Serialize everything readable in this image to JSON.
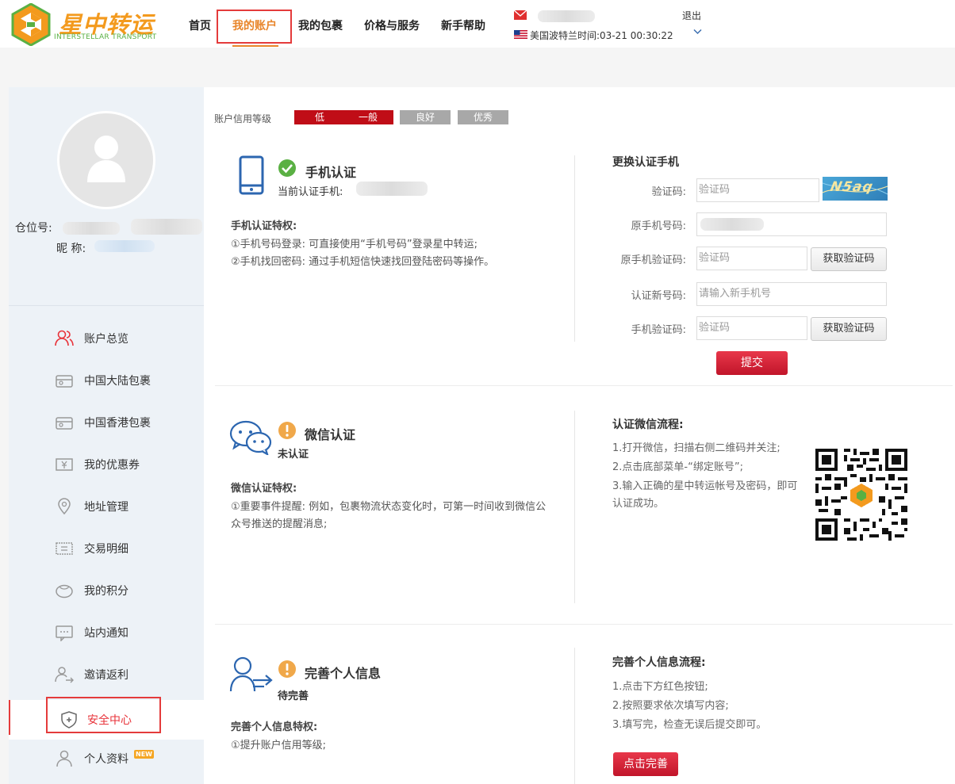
{
  "header": {
    "brand_cn": "星中转运",
    "brand_en": "INTERSTELLAR TRANSPORT",
    "nav": [
      {
        "label": "首页"
      },
      {
        "label": "我的账户"
      },
      {
        "label": "我的包裹"
      },
      {
        "label": "价格与服务"
      },
      {
        "label": "新手帮助"
      }
    ],
    "time_label": "美国波特兰时间:",
    "time_value": "03-21 00:30:22",
    "logout": "退出"
  },
  "sidebar": {
    "warehouse_label": "仓位号:",
    "nickname_label": "昵 称:",
    "items": [
      {
        "label": "账户总览",
        "icon": "user-group-icon"
      },
      {
        "label": "中国大陆包裹",
        "icon": "package-icon"
      },
      {
        "label": "中国香港包裹",
        "icon": "package-icon"
      },
      {
        "label": "我的优惠券",
        "icon": "coupon-icon"
      },
      {
        "label": "地址管理",
        "icon": "location-pin-icon"
      },
      {
        "label": "交易明细",
        "icon": "ledger-icon"
      },
      {
        "label": "我的积分",
        "icon": "points-icon"
      },
      {
        "label": "站内通知",
        "icon": "message-icon"
      },
      {
        "label": "邀请返利",
        "icon": "invite-icon"
      },
      {
        "label": "安全中心",
        "icon": "shield-icon"
      },
      {
        "label": "个人资料",
        "icon": "person-icon"
      }
    ],
    "new_badge": "NEW"
  },
  "credit": {
    "label": "账户信用等级",
    "levels": [
      {
        "label": "低"
      },
      {
        "label": "一般"
      },
      {
        "label": "良好"
      },
      {
        "label": "优秀"
      }
    ],
    "active_level_count": 2
  },
  "phone": {
    "title": "手机认证",
    "current_label": "当前认证手机:",
    "privileges_title": "手机认证特权:",
    "privilege_1": "①手机号码登录: 可直接使用“手机号码”登录星中转运;",
    "privilege_2": "②手机找回密码: 通过手机短信快速找回登陆密码等操作。",
    "form_title": "更换认证手机",
    "captcha_label": "验证码:",
    "captcha_placeholder": "验证码",
    "captcha_image_text": "N5aq",
    "old_phone_label": "原手机号码:",
    "old_code_label": "原手机验证码:",
    "old_code_placeholder": "验证码",
    "get_code": "获取验证码",
    "new_phone_label": "认证新号码:",
    "new_phone_placeholder": "请输入新手机号",
    "phone_code_label": "手机验证码:",
    "phone_code_placeholder": "验证码",
    "submit": "提交"
  },
  "wechat": {
    "title": "微信认证",
    "status": "未认证",
    "privileges_title": "微信认证特权:",
    "privilege_1": "①重要事件提醒: 例如，包裹物流状态变化时，可第一时间收到微信公众号推送的提醒消息;",
    "flow_title": "认证微信流程:",
    "step_1": "1.打开微信，扫描右侧二维码并关注;",
    "step_2": "2.点击底部菜单-“绑定账号”;",
    "step_3": "3.输入正确的星中转运帐号及密码，即可认证成功。"
  },
  "profile": {
    "title": "完善个人信息",
    "status": "待完善",
    "privileges_title": "完善个人信息特权:",
    "privilege_1": "①提升账户信用等级;",
    "flow_title": "完善个人信息流程:",
    "step_1": "1.点击下方红色按钮;",
    "step_2": "2.按照要求依次填写内容;",
    "step_3": "3.填写完，检查无误后提交即可。",
    "button": "点击完善"
  },
  "colors": {
    "brand_orange": "#e8852a",
    "brand_green": "#5ab043",
    "accent_red": "#c00d17",
    "sidebar_bg": "#edf2f7"
  }
}
